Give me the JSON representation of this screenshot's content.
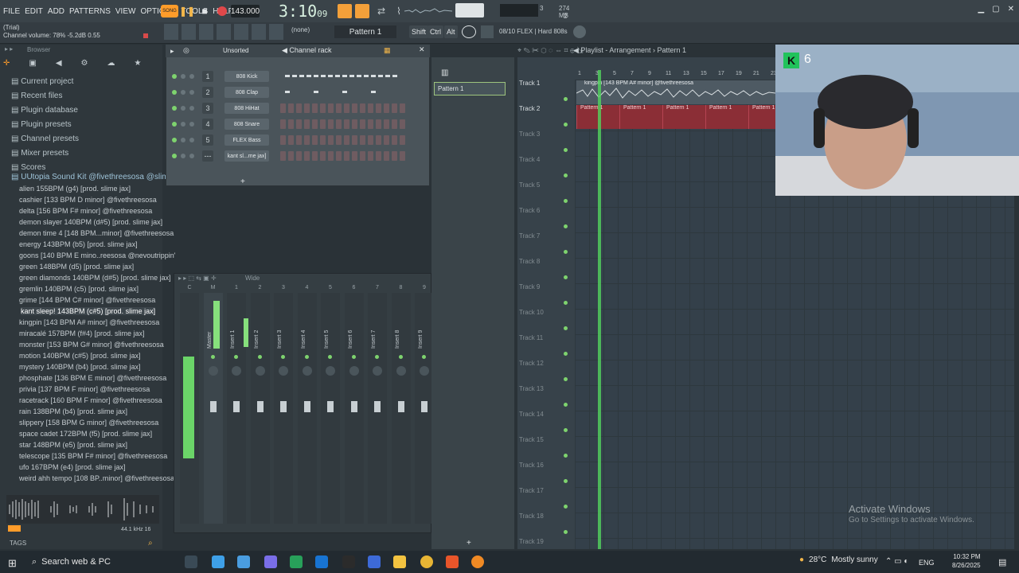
{
  "menu": [
    "FILE",
    "EDIT",
    "ADD",
    "PATTERNS",
    "VIEW",
    "OPTIONS",
    "TOOLS",
    "HELP"
  ],
  "transport": {
    "song_label": "SONG",
    "tempo": "143.000",
    "time_main": "3:10",
    "time_sub": "09"
  },
  "cpu": {
    "num": "3",
    "mem": "274 MB",
    "poly": "2"
  },
  "hint": {
    "line1": "(Trial)",
    "line2": "Channel volume: 78%  -5.2dB  0.55"
  },
  "toolbar2": {
    "none_label": "(none)",
    "pattern": "Pattern 1",
    "shift": "Shift",
    "ctrl": "Ctrl",
    "alt": "Alt",
    "preset": "08/10  FLEX | Hard 808s"
  },
  "browser": {
    "header": "Browser",
    "items": [
      "Current project",
      "Recent files",
      "Plugin database",
      "Plugin presets",
      "Channel presets",
      "Mixer presets",
      "Scores"
    ],
    "folder": "UUtopia Sound Kit @fivethreesosa @slimejax",
    "files": [
      "alien 155BPM (g4) [prod. slime jax]",
      "cashier [133 BPM D minor] @fivethreesosa",
      "delta [156 BPM F# minor] @fivethreesosa",
      "demon slayer 140BPM (d#5) [prod. slime jax]",
      "demon time 4 [148 BPM...minor] @fivethreesosa",
      "energy 143BPM (b5) [prod. slime jax]",
      "goons [140 BPM E mino..reesosa @nevoutrippin'",
      "green 148BPM (d5) [prod. slime jax]",
      "green diamonds 140BPM (d#5) [prod. slime jax]",
      "gremlin 140BPM (c5) [prod. slime jax]",
      "grime [144 BPM C# minor] @fivethreesosa",
      "kant sleep! 143BPM (c#5) [prod. slime jax]",
      "kingpin [143 BPM A# minor] @fivethreesosa",
      "miracalé 157BPM (f#4) [prod. slime jax]",
      "monster [153 BPM G# minor] @fivethreesosa",
      "motion 140BPM (c#5) [prod. slime jax]",
      "mystery 140BPM (b4) [prod. slime jax]",
      "phosphate [136 BPM E minor] @fivethreesosa",
      "privia [137 BPM F minor] @fivethreesosa",
      "racetrack [160 BPM F minor] @fivethreesosa",
      "rain 138BPM (b4) [prod. slime jax]",
      "slippery [158 BPM G minor] @fivethreesosa",
      "space cadet 172BPM (f5) [prod. slime jax]",
      "star 148BPM (e5) [prod. slime jax]",
      "telescope [135 BPM F# minor] @fivethreesosa",
      "ufo 167BPM (e4) [prod. slime jax]",
      "weird ahh tempo [108 BP..minor] @fivethreesosa"
    ],
    "selected_index": 11,
    "sample_rate": "44.1 kHz 16",
    "tags": "TAGS"
  },
  "channel_rack": {
    "title": "Channel rack",
    "sort": "Unsorted",
    "channels": [
      {
        "num": "1",
        "name": "808 Kick"
      },
      {
        "num": "2",
        "name": "808 Clap"
      },
      {
        "num": "3",
        "name": "808 HiHat"
      },
      {
        "num": "4",
        "name": "808 Snare"
      },
      {
        "num": "5",
        "name": "FLEX Bass"
      },
      {
        "num": "---",
        "name": "kant sl...me jax]"
      }
    ]
  },
  "mixer": {
    "view": "Wide",
    "master": "Master",
    "inserts": [
      "Insert 1",
      "Insert 2",
      "Insert 3",
      "Insert 4",
      "Insert 5",
      "Insert 6",
      "Insert 7",
      "Insert 8",
      "Insert 9"
    ],
    "numbers": [
      "C",
      "M",
      "1",
      "2",
      "3",
      "4",
      "5",
      "6",
      "7",
      "8",
      "9"
    ]
  },
  "pattern_list": {
    "item": "Pattern 1"
  },
  "playlist": {
    "breadcrumb": "Playlist - Arrangement › Pattern 1",
    "tracks": [
      "Track 1",
      "Track 2",
      "Track 3",
      "Track 4",
      "Track 5",
      "Track 6",
      "Track 7",
      "Track 8",
      "Track 9",
      "Track 10",
      "Track 11",
      "Track 12",
      "Track 13",
      "Track 14",
      "Track 15",
      "Track 16",
      "Track 17",
      "Track 18",
      "Track 19"
    ],
    "ruler": [
      "1",
      "3",
      "5",
      "7",
      "9",
      "11",
      "13",
      "15",
      "17",
      "19",
      "21",
      "23"
    ],
    "audio_clip": "kingpin [143 BPM A# minor] @fivethreesosa",
    "pattern_clips": [
      "Pattern 1",
      "Pattern 1",
      "Pattern 1",
      "Pattern 1",
      "Pattern 1"
    ]
  },
  "webcam": {
    "badge": "6"
  },
  "activate": {
    "title": "Activate Windows",
    "sub": "Go to Settings to activate Windows."
  },
  "taskbar": {
    "search": "Search web & PC",
    "temp": "28°C",
    "weather": "Mostly sunny",
    "lang": "ENG",
    "time": "10:32 PM",
    "date": "8/26/2025"
  },
  "colors": {
    "accent": "#ff9c2a",
    "playhead": "#53d45e",
    "step_on": "#a85560",
    "clip_red": "#8b2e36"
  }
}
